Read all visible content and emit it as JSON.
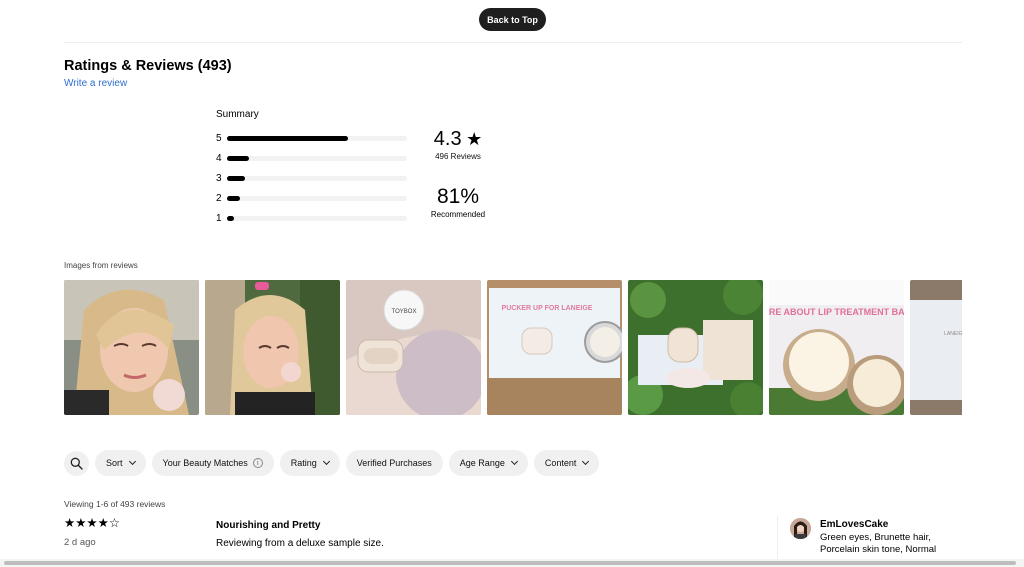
{
  "header": {
    "back_to_top": "Back to Top"
  },
  "reviews_header": {
    "title": "Ratings & Reviews (493)",
    "write_review": "Write a review"
  },
  "summary": {
    "label": "Summary",
    "distribution": [
      {
        "stars": "5",
        "fraction": 0.67
      },
      {
        "stars": "4",
        "fraction": 0.12
      },
      {
        "stars": "3",
        "fraction": 0.1
      },
      {
        "stars": "2",
        "fraction": 0.07
      },
      {
        "stars": "1",
        "fraction": 0.04
      }
    ],
    "average": "4.3",
    "average_star": "★",
    "review_count": "496 Reviews",
    "recommended": "81%",
    "recommended_label": "Recommended"
  },
  "images": {
    "label": "Images from reviews",
    "thumbs": [
      {
        "scene": "selfie-closeup",
        "logo_text": ""
      },
      {
        "scene": "selfie-garden",
        "logo_text": ""
      },
      {
        "scene": "toybox-card",
        "logo_text": "TOYBOX"
      },
      {
        "scene": "laneige-card",
        "logo_text": "PUCKER UP FOR LANEIGE"
      },
      {
        "scene": "plants-tin",
        "logo_text": ""
      },
      {
        "scene": "open-jar",
        "logo_text": "MORE ABOUT LIP TREATMENT BALM"
      },
      {
        "scene": "partial-box",
        "logo_text": "LANEIGE"
      }
    ]
  },
  "filters": {
    "search_icon": "search-icon",
    "chips": [
      {
        "label": "Sort",
        "chevron": true,
        "info": false
      },
      {
        "label": "Your Beauty Matches",
        "chevron": false,
        "info": true
      },
      {
        "label": "Rating",
        "chevron": true,
        "info": false
      },
      {
        "label": "Verified Purchases",
        "chevron": false,
        "info": false
      },
      {
        "label": "Age Range",
        "chevron": true,
        "info": false
      },
      {
        "label": "Content",
        "chevron": true,
        "info": false
      }
    ]
  },
  "review_list": {
    "viewing": "Viewing 1-6 of 493 reviews",
    "first_review": {
      "stars": "★★★★☆",
      "rating": 4,
      "date": "2 d ago",
      "title": "Nourishing and Pretty",
      "body": "Reviewing from a deluxe sample size.",
      "reviewer": {
        "name": "EmLovesCake",
        "attributes": "Green eyes, Brunette hair, Porcelain skin tone, Normal"
      }
    }
  }
}
